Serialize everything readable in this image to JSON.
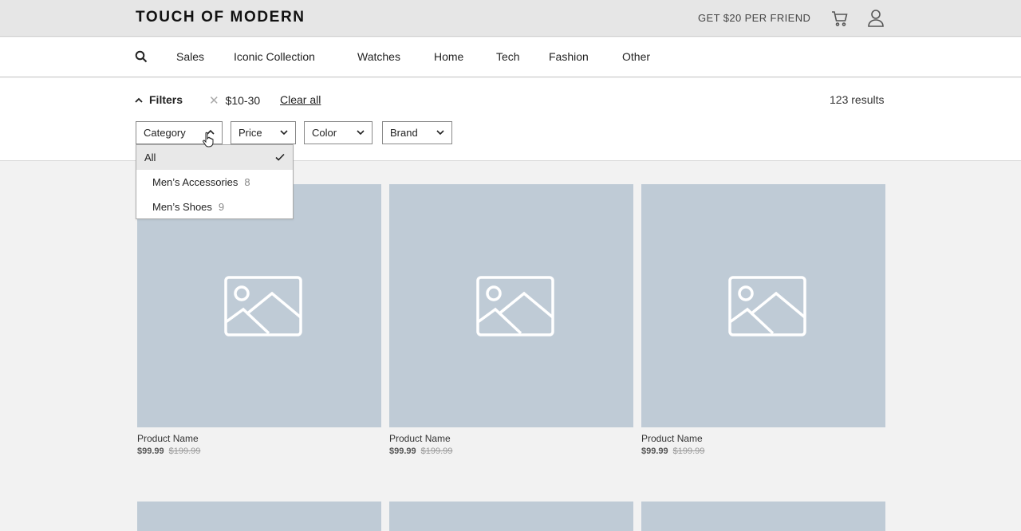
{
  "header": {
    "logo": "TOUCH OF MODERN",
    "promo": "GET $20 PER FRIEND",
    "icons": {
      "cart": "cart-icon",
      "user": "user-icon"
    }
  },
  "nav": {
    "search_icon": "search-icon",
    "items": [
      "Sales",
      "Iconic Collection",
      "Watches",
      "Home",
      "Tech",
      "Fashion",
      "Other"
    ]
  },
  "filters": {
    "toggle_label": "Filters",
    "active_chip": "$10-30",
    "clear_all": "Clear all",
    "results": "123 results",
    "dropdowns": [
      "Category",
      "Price",
      "Color",
      "Brand"
    ]
  },
  "category_menu": {
    "items": [
      {
        "label": "All",
        "selected": true
      },
      {
        "label": "Men’s Accessories",
        "count": "8"
      },
      {
        "label": "Men’s Shoes",
        "count": "9"
      }
    ]
  },
  "products": [
    {
      "name": "Product Name",
      "price": "$99.99",
      "original_price": "$199.99"
    },
    {
      "name": "Product Name",
      "price": "$99.99",
      "original_price": "$199.99"
    },
    {
      "name": "Product Name",
      "price": "$99.99",
      "original_price": "$199.99"
    }
  ],
  "colors": {
    "topbar_bg": "#e6e6e6",
    "placeholder": "#bfcbd6",
    "page_bg": "#f2f2f2"
  }
}
